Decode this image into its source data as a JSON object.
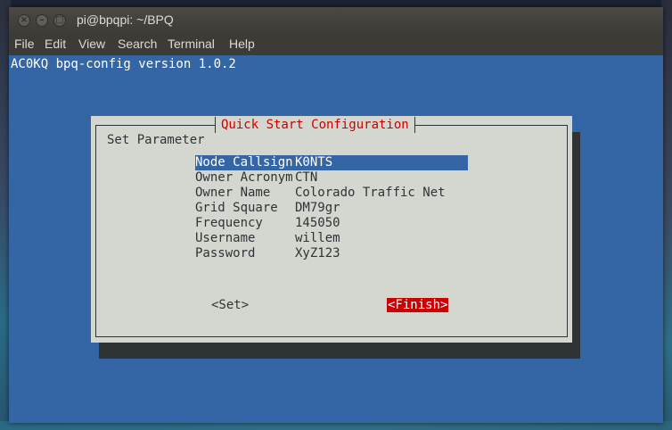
{
  "window": {
    "title": "pi@bpqpi: ~/BPQ",
    "close_glyph": "×",
    "minimize_glyph": "–",
    "maximize_glyph": "□"
  },
  "menu": [
    "File",
    "Edit",
    "View",
    "Search",
    "Terminal",
    "Help"
  ],
  "terminal": {
    "header": "AC0KQ bpq-config version 1.0.2"
  },
  "dialog": {
    "title": "Quick Start Configuration",
    "prompt": "Set Parameter",
    "fields": [
      {
        "label": "Node Callsign",
        "value": "K0NTS",
        "selected": true
      },
      {
        "label": "Owner Acronym",
        "value": "CTN"
      },
      {
        "label": "Owner Name",
        "value": "Colorado Traffic Net"
      },
      {
        "label": "Grid Square",
        "value": "DM79gr"
      },
      {
        "label": "Frequency",
        "value": "145050"
      },
      {
        "label": "Username",
        "value": "willem"
      },
      {
        "label": "Password",
        "value": "XyZ123"
      }
    ],
    "set_button": "<Set>",
    "finish_button": "<Finish>"
  },
  "colors": {
    "terminal_bg": "#3465a4",
    "dialog_bg": "#d3d7cf",
    "title_red": "#cc0000",
    "selection_blue": "#3465a4",
    "finish_red": "#cc0000"
  }
}
